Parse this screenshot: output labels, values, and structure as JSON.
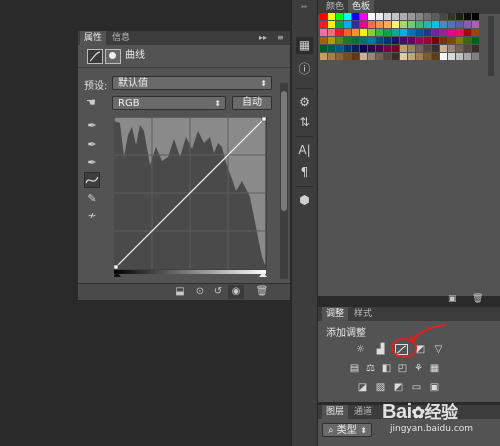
{
  "properties_panel": {
    "tab_properties": "属性",
    "tab_info": "信息",
    "collapse_glyph": "▸▸",
    "menu_glyph": "≡",
    "header_title": "曲线",
    "preset_label": "预设:",
    "preset_value": "默认值",
    "channel_value": "RGB",
    "auto_button": "自动"
  },
  "swatches_panel": {
    "tab_color": "颜色",
    "tab_swatches": "色板"
  },
  "adjust_panel": {
    "tab_adjust": "调整",
    "tab_styles": "样式",
    "add_label": "添加调整"
  },
  "layers_panel": {
    "tab_layers": "图层",
    "tab_channels": "通道",
    "filter_value": "类型"
  },
  "watermark": {
    "brand_text": "Bai",
    "brand_cn": "经验",
    "url": "jingyan.baidu.com"
  },
  "colors": {
    "annotation_red": "#e02020",
    "panel_bg": "#535353"
  }
}
